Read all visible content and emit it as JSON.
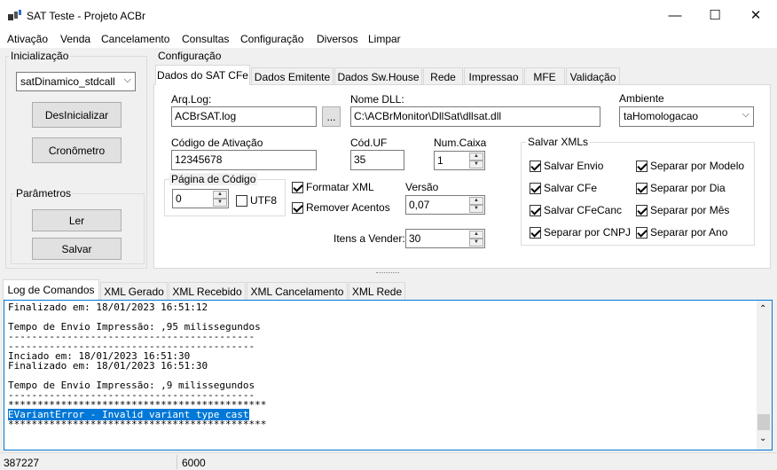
{
  "window": {
    "title": "SAT Teste - Projeto ACBr",
    "minimize": "—",
    "maximize": "☐",
    "close": "✕"
  },
  "menu": [
    "Ativação",
    "Venda",
    "Cancelamento",
    "Consultas",
    "Configuração",
    "Diversos",
    "Limpar"
  ],
  "inicializacao": {
    "label": "Inicialização",
    "dll_combo": "satDinamico_stdcall",
    "desinicializar": "DesInicializar",
    "cronometro": "Cronômetro"
  },
  "parametros": {
    "label": "Parâmetros",
    "ler": "Ler",
    "salvar": "Salvar"
  },
  "configuracao": {
    "label": "Configuração",
    "tabs": [
      "Dados do SAT CFe",
      "Dados Emitente",
      "Dados Sw.House",
      "Rede",
      "Impressao",
      "MFE",
      "Validação"
    ],
    "arq_log_label": "Arq.Log:",
    "arq_log_value": "ACBrSAT.log",
    "browse": "...",
    "nome_dll_label": "Nome DLL:",
    "nome_dll_value": "C:\\ACBrMonitor\\DllSat\\dllsat.dll",
    "ambiente_label": "Ambiente",
    "ambiente_value": "taHomologacao",
    "codigo_ativacao_label": "Código de Ativação",
    "codigo_ativacao_value": "12345678",
    "cod_uf_label": "Cód.UF",
    "cod_uf_value": "35",
    "num_caixa_label": "Num.Caixa",
    "num_caixa_value": "1",
    "pagina_codigo_label": "Página de Código",
    "pagina_codigo_value": "0",
    "utf8_label": "UTF8",
    "formatar_xml": "Formatar XML",
    "remover_acentos": "Remover Acentos",
    "versao_label": "Versão",
    "versao_value": "0,07",
    "itens_vender_label": "Itens a Vender:",
    "itens_vender_value": "30"
  },
  "salvar_xmls": {
    "label": "Salvar XMLs",
    "salvar_envio": "Salvar Envio",
    "salvar_cfe": "Salvar CFe",
    "salvar_cfecanc": "Salvar CFeCanc",
    "separar_cnpj": "Separar por CNPJ",
    "separar_modelo": "Separar por Modelo",
    "separar_dia": "Separar por Dia",
    "separar_mes": "Separar por Mês",
    "separar_ano": "Separar por Ano"
  },
  "bottom_tabs": [
    "Log de Comandos",
    "XML Gerado",
    "XML Recebido",
    "XML Cancelamento",
    "XML Rede"
  ],
  "log": {
    "lines": [
      "Finalizado em: 18/01/2023 16:51:12",
      "",
      "Tempo de Envio Impressão: ,95 milissegundos",
      "------------------------------------------",
      "------------------------------------------",
      "Inciado em: 18/01/2023 16:51:30",
      "Finalizado em: 18/01/2023 16:51:30",
      "",
      "Tempo de Envio Impressão: ,9 milissegundos",
      "------------------------------------------",
      "********************************************",
      "EVariantError - Invalid variant type cast",
      "********************************************"
    ],
    "highlighted_line": 11
  },
  "status": {
    "left": "387227",
    "right": "6000"
  }
}
